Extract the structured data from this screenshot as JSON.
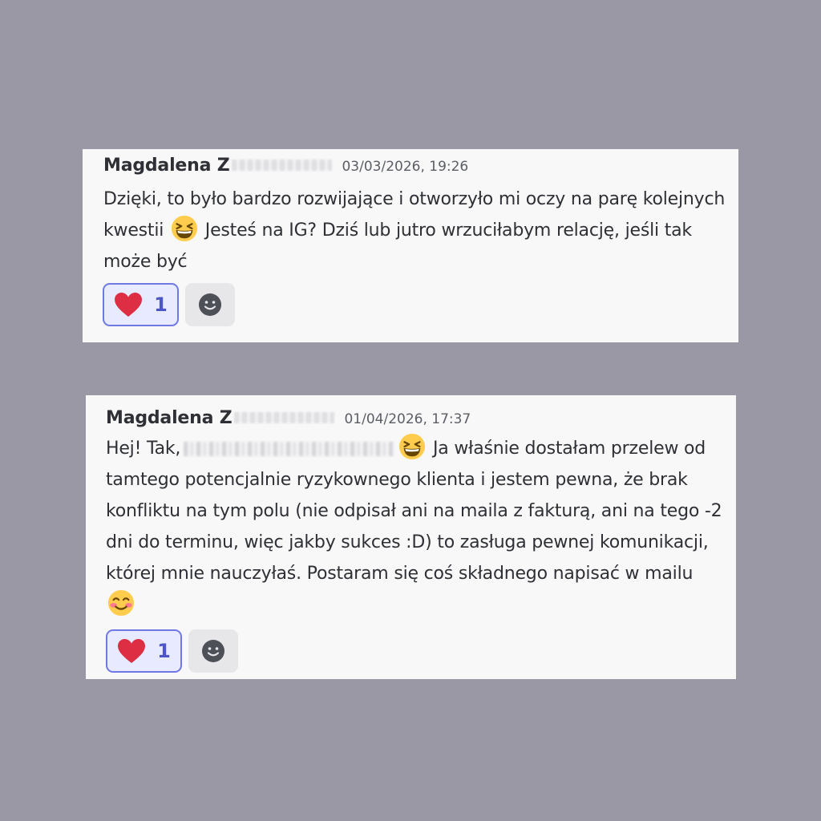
{
  "messages": [
    {
      "author": "Magdalena Z",
      "timestamp": "03/03/2026, 19:26",
      "text_a": "Dzięki, to było bardzo rozwijające i otworzyło mi oczy na parę kolejnych kwestii",
      "emoji_a": "grinning-squinting-face",
      "text_b": "Jesteś na IG? Dziś lub jutro wrzuciłabym relację, jeśli tak może być",
      "reaction": {
        "emoji": "heart",
        "count": "1"
      }
    },
    {
      "author": "Magdalena Z",
      "timestamp": "01/04/2026, 17:37",
      "text_a": "Hej! Tak,",
      "emoji_a": "grinning-squinting-face",
      "text_b": "Ja właśnie dostałam przelew od tamtego potencjalnie ryzykownego klienta i jestem pewna, że brak konfliktu na tym polu (nie odpisał ani na maila z fakturą, ani na tego -2 dni do terminu, więc jakby sukces :D) to zasługa pewnej komunikacji, której mnie nauczyłaś. Postaram się coś składnego napisać w mailu",
      "emoji_b": "smiling-face-with-blushing-cheeks",
      "reaction": {
        "emoji": "heart",
        "count": "1"
      }
    }
  ],
  "colors": {
    "background": "#9a98a5",
    "card": "#f8f8f8",
    "reaction_border": "#6e78e6",
    "reaction_bg": "#e8ebff",
    "heart": "#dd2e44",
    "emoji_yellow": "#ffcc4d"
  },
  "icons": [
    "heart-icon",
    "add-reaction-icon",
    "grinning-squinting-face-icon",
    "smiling-face-with-blushing-cheeks-icon"
  ]
}
